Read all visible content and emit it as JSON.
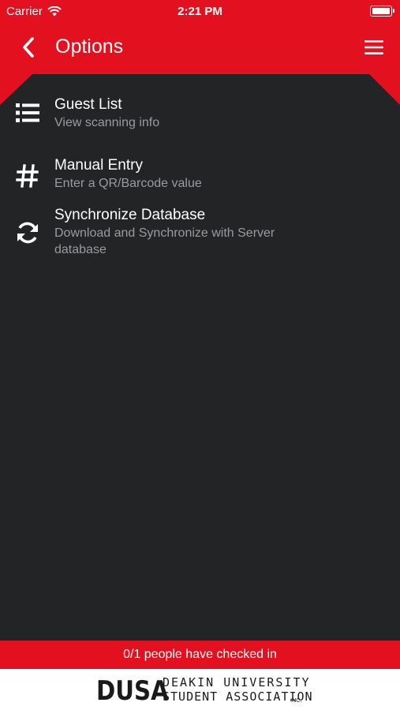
{
  "status_bar": {
    "carrier": "Carrier",
    "time": "2:21 PM"
  },
  "header": {
    "title": "Options"
  },
  "options": [
    {
      "title": "Guest List",
      "subtitle": "View scanning info",
      "icon": "list-icon"
    },
    {
      "title": "Manual Entry",
      "subtitle": "Enter a QR/Barcode value",
      "icon": "hash-icon"
    },
    {
      "title": "Synchronize Database",
      "subtitle": "Download and Synchronize with Server database",
      "icon": "sync-icon"
    }
  ],
  "footer": {
    "checked_in": "0/1 people have checked in"
  },
  "logo": {
    "acronym": "DUSA",
    "line1": "DEAKIN UNIVERSITY",
    "line2": "STUDENT ASSOCIATION",
    "suffix": "INC."
  },
  "colors": {
    "accent": "#e3101f",
    "background": "#232426",
    "subtitle": "#9a9b9e"
  }
}
